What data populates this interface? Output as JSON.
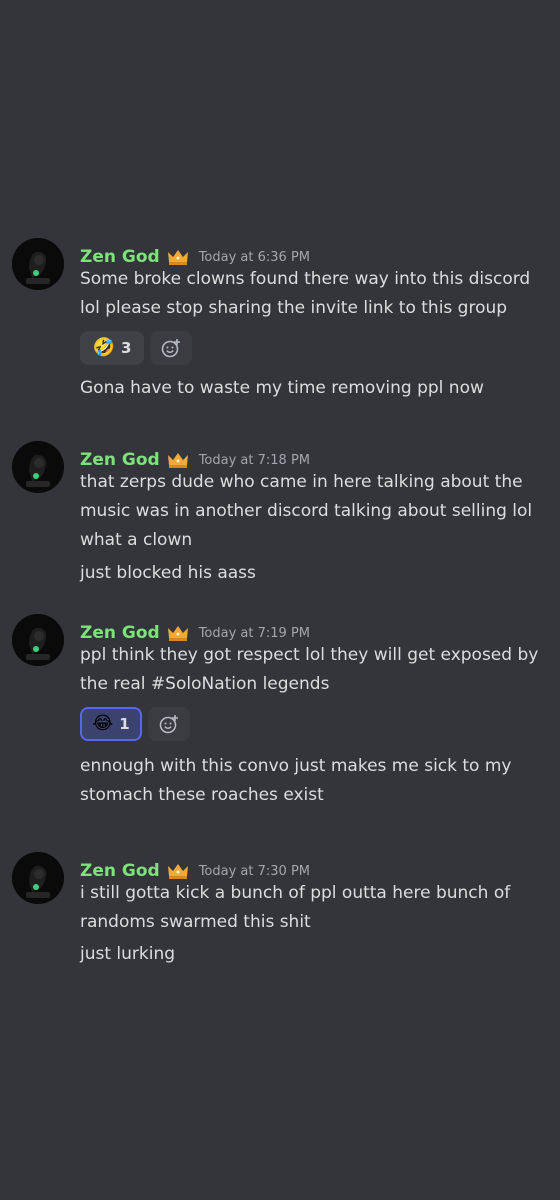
{
  "messages": [
    {
      "username": "Zen God",
      "timestamp": "Today at 6:36 PM",
      "lines": [
        "Some broke clowns found there way into this discord",
        "lol please stop sharing the invite link to this group"
      ],
      "reaction": {
        "emoji": "🤣",
        "count": "3"
      },
      "followup": [
        "Gona have to waste my time removing ppl now"
      ]
    },
    {
      "username": "Zen God",
      "timestamp": "Today at 7:18 PM",
      "lines": [
        "that zerps dude who came in here talking about the",
        "music was in another discord talking about selling lol",
        "what a clown"
      ],
      "followup": [
        "just blocked his aass"
      ]
    },
    {
      "username": "Zen God",
      "timestamp": "Today at 7:19 PM",
      "lines": [
        "ppl think they got respect lol they will get exposed by",
        "the real #SoloNation legends"
      ],
      "reaction": {
        "emoji": "😂",
        "count": "1"
      },
      "followup": [
        "ennough with this convo just makes me sick to my",
        "stomach these roaches exist"
      ]
    },
    {
      "username": "Zen God",
      "timestamp": "Today at 7:30 PM",
      "lines": [
        "i still gotta kick a bunch of ppl outta here bunch of",
        "randoms swarmed this shit"
      ],
      "followup": [
        "just lurking"
      ]
    }
  ],
  "icons": {
    "badge": "crown-icon",
    "add_reaction": "add-reaction-icon"
  },
  "colors": {
    "background": "#33353b",
    "username": "#7ee27a",
    "text": "#dcddde",
    "timestamp": "#a3a6ab",
    "reaction_active_border": "#5865f2"
  }
}
